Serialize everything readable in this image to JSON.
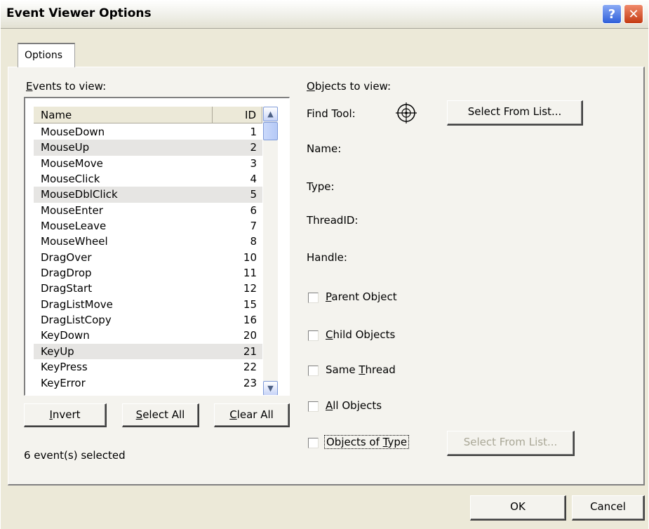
{
  "window": {
    "title": "Event Viewer Options"
  },
  "title_buttons": {
    "help": "?",
    "close": "✕"
  },
  "tabs": [
    {
      "label": "Options"
    }
  ],
  "events": {
    "label_ul": "E",
    "label_rest": "vents to view:",
    "columns": {
      "name": "Name",
      "id": "ID"
    },
    "rows": [
      {
        "name": "MouseDown",
        "id": "1",
        "selected": false
      },
      {
        "name": "MouseUp",
        "id": "2",
        "selected": true
      },
      {
        "name": "MouseMove",
        "id": "3",
        "selected": false
      },
      {
        "name": "MouseClick",
        "id": "4",
        "selected": false
      },
      {
        "name": "MouseDblClick",
        "id": "5",
        "selected": true
      },
      {
        "name": "MouseEnter",
        "id": "6",
        "selected": false
      },
      {
        "name": "MouseLeave",
        "id": "7",
        "selected": false
      },
      {
        "name": "MouseWheel",
        "id": "8",
        "selected": false
      },
      {
        "name": "DragOver",
        "id": "10",
        "selected": false
      },
      {
        "name": "DragDrop",
        "id": "11",
        "selected": false
      },
      {
        "name": "DragStart",
        "id": "12",
        "selected": false
      },
      {
        "name": "DragListMove",
        "id": "15",
        "selected": false
      },
      {
        "name": "DragListCopy",
        "id": "16",
        "selected": false
      },
      {
        "name": "KeyDown",
        "id": "20",
        "selected": false
      },
      {
        "name": "KeyUp",
        "id": "21",
        "selected": true
      },
      {
        "name": "KeyPress",
        "id": "22",
        "selected": false
      },
      {
        "name": "KeyError",
        "id": "23",
        "selected": false
      }
    ],
    "buttons": {
      "invert": {
        "ul": "I",
        "rest": "nvert"
      },
      "select_all": {
        "ul": "S",
        "rest": "elect All"
      },
      "clear_all": {
        "ul": "C",
        "rest": "lear All"
      }
    },
    "status": "6 event(s) selected"
  },
  "objects": {
    "label_ul": "O",
    "label_rest": "bjects to view:",
    "find_tool_label": "Find Tool:",
    "find_tool_icon": "crosshair-target-icon",
    "select_from_list": "Select From List...",
    "name_label": "Name:",
    "type_label": "Type:",
    "threadid_label": "ThreadID:",
    "handle_label": "Handle:",
    "checkboxes": {
      "parent": {
        "pre": "",
        "ul": "P",
        "rest": "arent Object",
        "checked": false
      },
      "child": {
        "pre": "",
        "ul": "C",
        "rest": "hild Objects",
        "checked": false
      },
      "same_thread": {
        "pre": "Same ",
        "ul": "T",
        "rest": "hread",
        "checked": false
      },
      "all": {
        "pre": "",
        "ul": "A",
        "rest": "ll Objects",
        "checked": false
      },
      "of_type": {
        "pre": "Objects of ",
        "ul": "T",
        "rest": "ype",
        "checked": false
      }
    },
    "select_from_list_disabled": "Select From List..."
  },
  "footer": {
    "ok": "OK",
    "cancel": "Cancel"
  },
  "colors": {
    "dialog_bg": "#ece9d8",
    "selected_row": "#e6e5e3",
    "disabled_text": "#a9a796"
  }
}
